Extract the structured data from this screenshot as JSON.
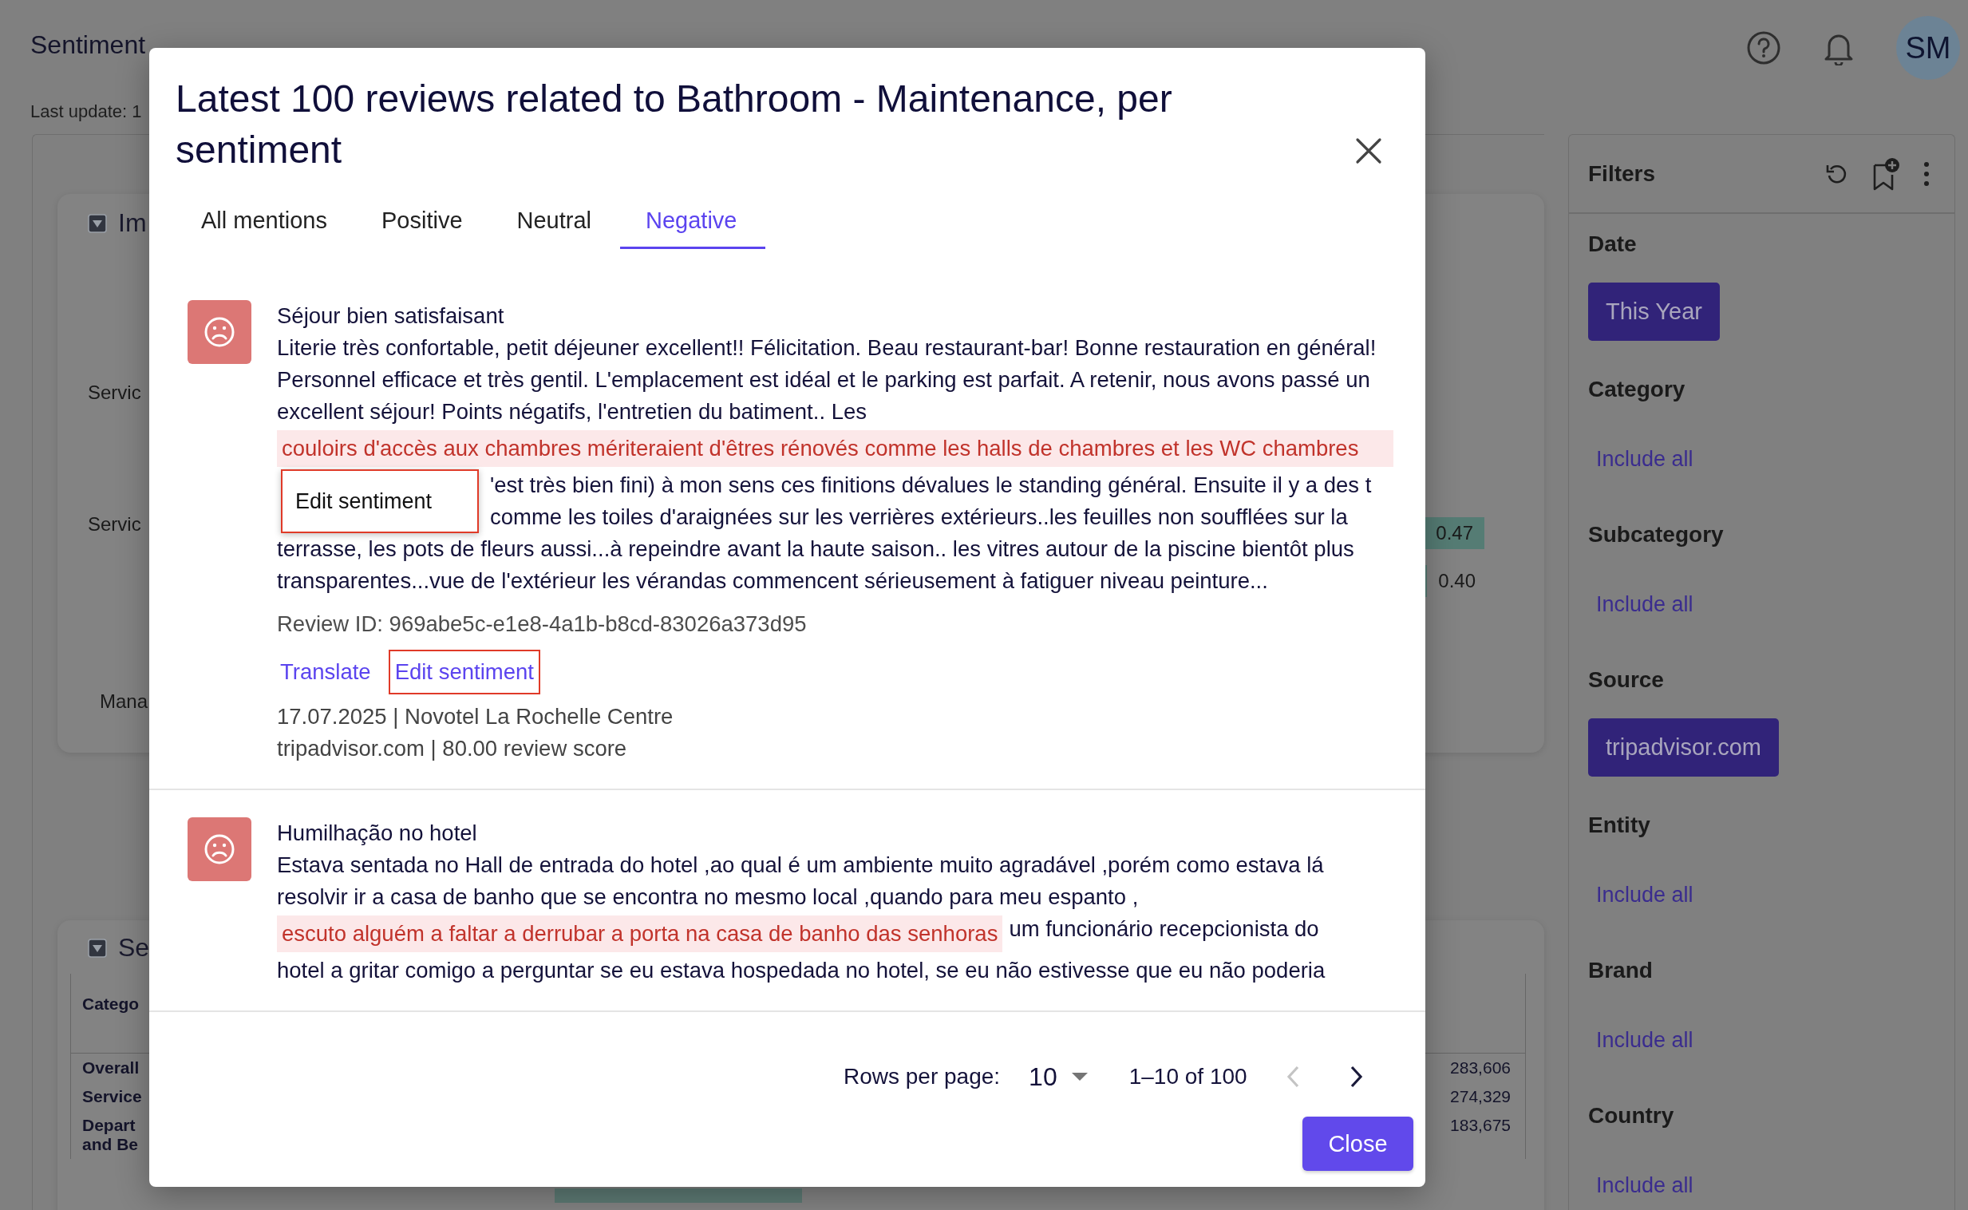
{
  "header": {
    "title": "Sentiment",
    "last_update": "Last update: 1",
    "avatar": "SM"
  },
  "impact_card": {
    "title": "Im",
    "row_labels": [
      "Servic",
      "Servic",
      "Mana"
    ],
    "values": [
      {
        "text": "0.47",
        "kind": "filled"
      },
      {
        "text": "0.40",
        "kind": "edge"
      }
    ]
  },
  "summary_card": {
    "title": "Se",
    "column_1": "Catego",
    "rows": [
      {
        "label": "Overall",
        "value": "283,606"
      },
      {
        "label": "Service",
        "value": "274,329"
      },
      {
        "label": "Depart and Be",
        "value": "183,675"
      }
    ]
  },
  "filters": {
    "title": "Filters",
    "groups": [
      {
        "label": "Date",
        "kind": "chip",
        "value": "This Year"
      },
      {
        "label": "Category",
        "kind": "link",
        "value": "Include all"
      },
      {
        "label": "Subcategory",
        "kind": "link",
        "value": "Include all"
      },
      {
        "label": "Source",
        "kind": "chip",
        "value": "tripadvisor.com"
      },
      {
        "label": "Entity",
        "kind": "link",
        "value": "Include all"
      },
      {
        "label": "Brand",
        "kind": "link",
        "value": "Include all"
      },
      {
        "label": "Country",
        "kind": "link",
        "value": "Include all"
      }
    ]
  },
  "modal": {
    "title": "Latest 100 reviews related to Bathroom - Maintenance, per sentiment",
    "tabs": [
      {
        "label": "All mentions",
        "selected": false
      },
      {
        "label": "Positive",
        "selected": false
      },
      {
        "label": "Neutral",
        "selected": false
      },
      {
        "label": "Negative",
        "selected": true
      }
    ],
    "reviews": [
      {
        "title": "Séjour bien satisfaisant",
        "lines": [
          [
            {
              "kind": "text",
              "text": "Literie très confortable, petit déjeuner excellent!! Félicitation. Beau restaurant-bar! Bonne restauration en général! Personnel efficace et très gentil. L'emplacement est idéal et le parking est parfait. A retenir, nous avons passé un excellent séjour! Points négatifs, l'entretien du batiment.. Les"
            }
          ],
          [
            {
              "kind": "highlight",
              "text": "couloirs d'accès aux chambres mériteraient d'êtres rénovés comme les halls de chambres et les WC chambres"
            }
          ],
          [
            {
              "kind": "menu",
              "text": "Edit sentiment",
              "outlined": true
            },
            {
              "kind": "text",
              "text": "'est très bien fini) à mon sens ces finitions dévalues le standing général. Ensuite il y a des t comme les toiles d'araignées sur les verrières extérieurs..les feuilles non soufflées sur la"
            }
          ],
          [
            {
              "kind": "text",
              "text": "terrasse, les pots de fleurs aussi...à repeindre avant la haute saison.. les vitres autour de la piscine bientôt plus transparentes...vue de l'extérieur les vérandas commencent sérieusement à fatiguer niveau peinture..."
            }
          ]
        ],
        "review_id": "Review ID: 969abe5c-e1e8-4a1b-b8cd-83026a373d95",
        "actions": [
          {
            "label": "Translate",
            "outlined": false
          },
          {
            "label": "Edit sentiment",
            "outlined": true
          }
        ],
        "meta": [
          "17.07.2025 | Novotel La Rochelle Centre",
          "tripadvisor.com | 80.00 review score"
        ]
      },
      {
        "title": "Humilhação no hotel",
        "lines": [
          [
            {
              "kind": "text",
              "text": "Estava sentada no Hall de entrada do hotel ,ao qual é um ambiente muito agradável ,porém como estava lá resolvir ir a casa de banho que se encontra no mesmo local ,quando para meu espanto ,"
            }
          ],
          [
            {
              "kind": "highlight",
              "text": "escuto alguém a faltar a derrubar a porta na casa de banho das senhoras"
            },
            {
              "kind": "text",
              "text": "um funcionário recepcionista do"
            }
          ],
          [
            {
              "kind": "text",
              "text": "hotel a gritar comigo a perguntar se eu estava hospedada no hotel, se eu não estivesse que eu não poderia"
            }
          ]
        ]
      }
    ],
    "pagination": {
      "rows_label": "Rows per page:",
      "rows_value": "10",
      "range": "1–10 of 100"
    },
    "close_button": "Close"
  }
}
